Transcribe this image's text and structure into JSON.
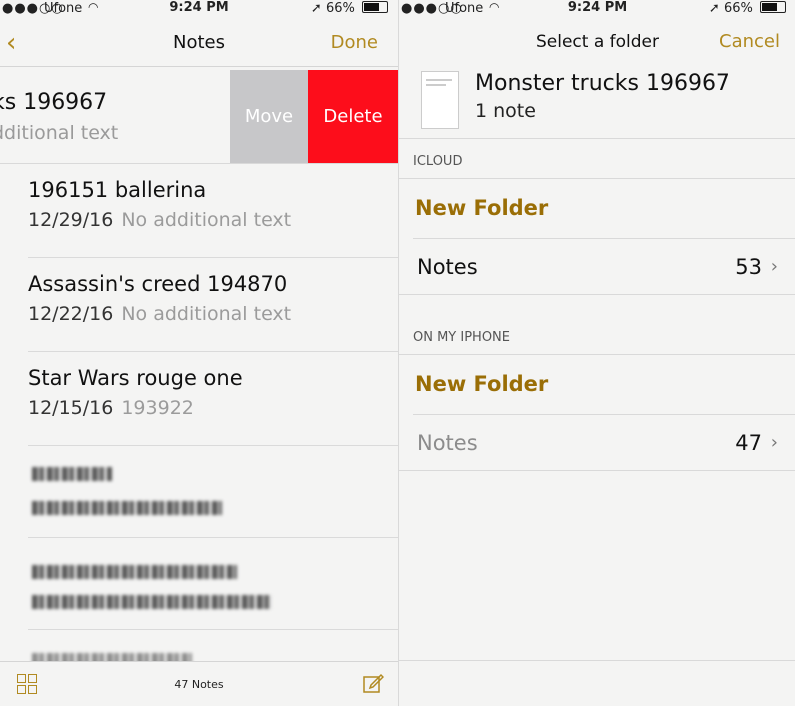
{
  "left": {
    "status": {
      "carrier": "Ufone",
      "time": "9:24 PM",
      "battery": "66%"
    },
    "nav": {
      "title": "Notes",
      "done": "Done"
    },
    "swiped_note": {
      "title": "ks 196967",
      "subtitle": "dditional text"
    },
    "actions": {
      "move": "Move",
      "delete": "Delete"
    },
    "notes": [
      {
        "title": "196151 ballerina",
        "date": "12/29/16",
        "preview": "No additional text"
      },
      {
        "title": "Assassin's creed 194870",
        "date": "12/22/16",
        "preview": "No additional text"
      },
      {
        "title": "Star Wars rouge one",
        "date": "12/15/16",
        "preview": "193922"
      }
    ],
    "bottom": {
      "count": "47 Notes"
    }
  },
  "right": {
    "status": {
      "carrier": "Ufone",
      "time": "9:24 PM",
      "battery": "66%"
    },
    "nav": {
      "title": "Select a folder",
      "cancel": "Cancel"
    },
    "moving_note": {
      "title": "Monster trucks 196967",
      "subtitle": "1 note"
    },
    "icloud": {
      "header": "ICLOUD",
      "new_folder": "New Folder",
      "folder": {
        "name": "Notes",
        "count": "53"
      }
    },
    "iphone": {
      "header": "ON MY IPHONE",
      "new_folder": "New Folder",
      "folder": {
        "name": "Notes",
        "count": "47"
      }
    }
  }
}
